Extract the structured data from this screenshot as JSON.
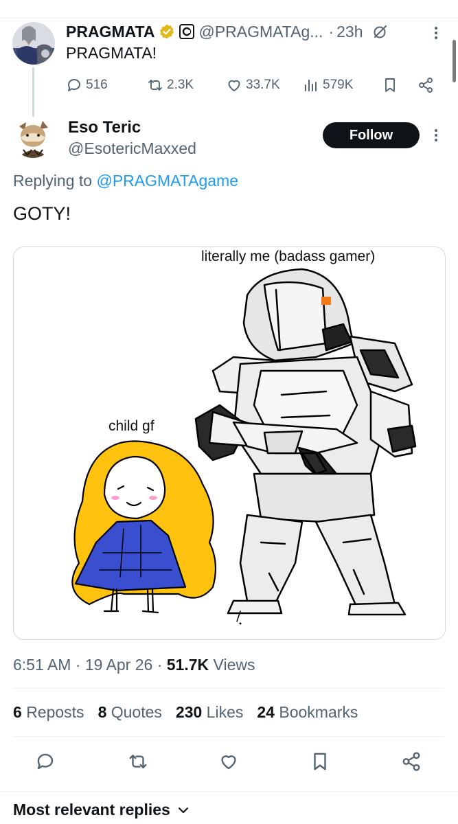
{
  "parent_tweet": {
    "display_name": "PRAGMATA",
    "handle": "@PRAGMATAg...",
    "separator": "·",
    "time": "23h",
    "text": "PRAGMATA!",
    "stats": {
      "replies": "516",
      "reposts": "2.3K",
      "likes": "33.7K",
      "views": "579K"
    }
  },
  "tweet": {
    "display_name": "Eso Teric",
    "handle": "@EsotericMaxxed",
    "follow_label": "Follow",
    "replying_prefix": "Replying to ",
    "replying_mention": "@PRAGMATAgame",
    "text": "GOTY!",
    "image": {
      "label_top": "literally me (badass gamer)",
      "label_left": "child gf"
    },
    "time": "6:51 AM",
    "date": "19 Apr 26",
    "views_count": "51.7K",
    "views_label": "Views",
    "sep": " · "
  },
  "stats": [
    {
      "count": "6",
      "label": "Reposts"
    },
    {
      "count": "8",
      "label": "Quotes"
    },
    {
      "count": "230",
      "label": "Likes"
    },
    {
      "count": "24",
      "label": "Bookmarks"
    }
  ],
  "replies_sort": {
    "label": "Most relevant replies"
  },
  "colors": {
    "accent": "#1d9bf0",
    "text": "#0f1419",
    "muted": "#536471",
    "verified_gold": "#e2b719"
  }
}
